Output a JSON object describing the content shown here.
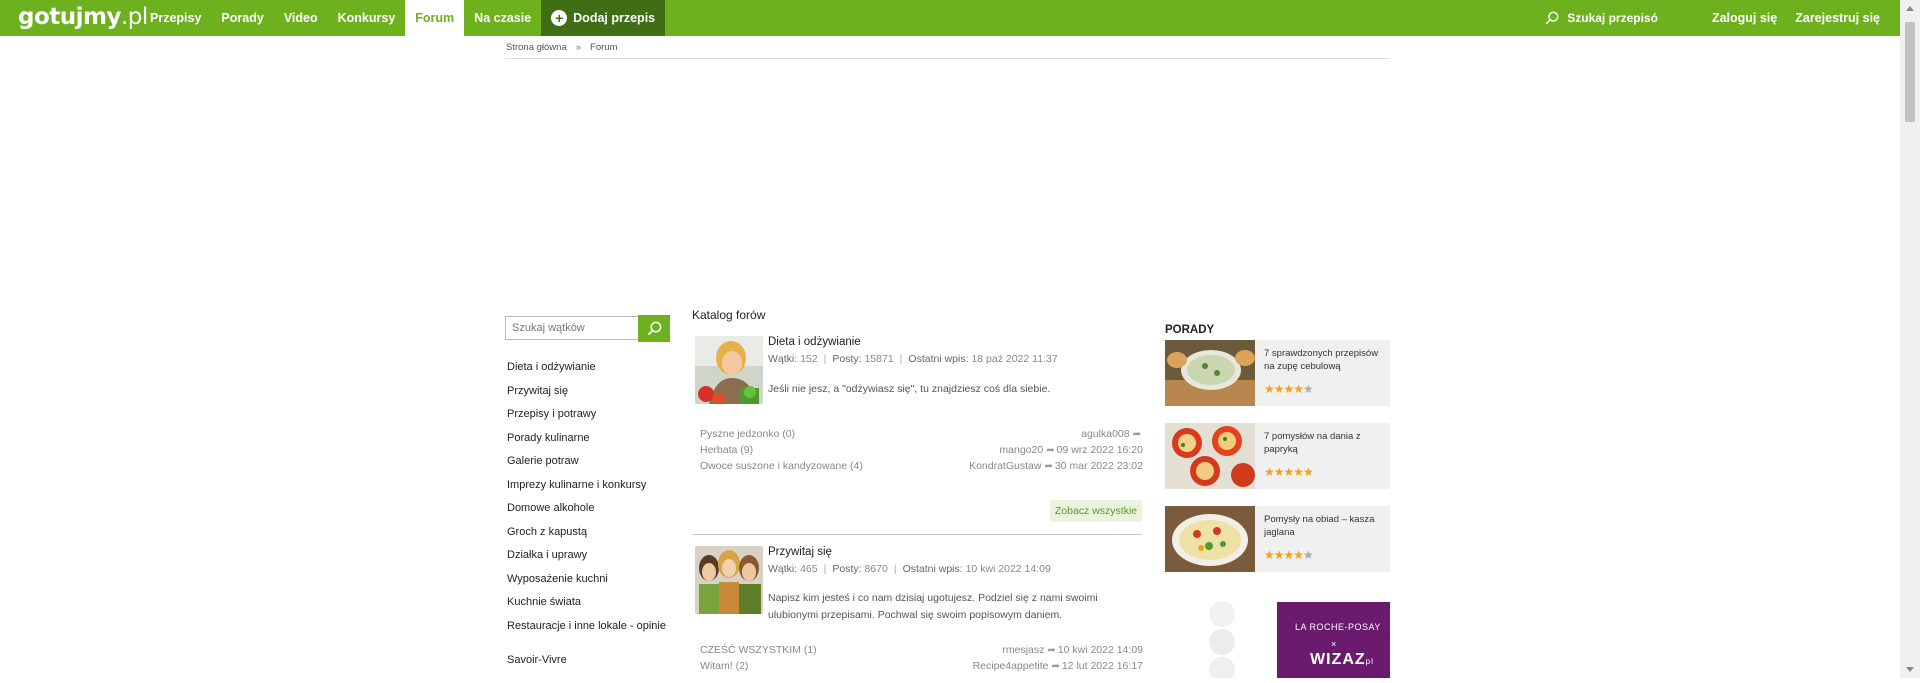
{
  "header": {
    "logo_main": "gotujmy",
    "logo_tld": ".pl",
    "nav": [
      {
        "label": "Przepisy"
      },
      {
        "label": "Porady"
      },
      {
        "label": "Video"
      },
      {
        "label": "Konkursy"
      },
      {
        "label": "Forum",
        "active": true
      },
      {
        "label": "Na czasie"
      }
    ],
    "add_recipe_label": "Dodaj przepis",
    "search_placeholder": "Szukaj przepisó",
    "login_label": "Zaloguj się",
    "register_label": "Zarejestruj się"
  },
  "breadcrumb": {
    "home": "Strona główna",
    "separator": "»",
    "current": "Forum"
  },
  "sidebar": {
    "search_placeholder": "Szukaj wątków",
    "items": [
      "Dieta i odżywianie",
      "Przywitaj się",
      "Przepisy i potrawy",
      "Porady kulinarne",
      "Galerie potraw",
      "Imprezy kulinarne i konkursy",
      "Domowe alkohole",
      "Groch z kapustą",
      "Działka i uprawy",
      "Wyposażenie kuchni",
      "Kuchnie świata",
      "Restauracje i inne lokale - opinie",
      "Savoir-Vivre"
    ]
  },
  "catalog": {
    "title": "Katalog forów",
    "forums": [
      {
        "title": "Dieta i odżywianie",
        "threads_label": "Wątki:",
        "threads": "152",
        "posts_label": "Posty:",
        "posts": "15871",
        "last_label": "Ostatni wpis:",
        "last": "18 paź 2022 11:37",
        "description": "Jeśli nie jesz, a \"odżywiasz się\", tu znajdziesz coś dla siebie.",
        "threads_list": [
          {
            "title": "Pyszne jedzonko",
            "count": "(0)",
            "user": "agulka008",
            "date": ""
          },
          {
            "title": "Herbata",
            "count": "(9)",
            "user": "mango20",
            "date": "09 wrz 2022 16:20"
          },
          {
            "title": "Owoce suszone i kandyzowane",
            "count": "(4)",
            "user": "KondratGustaw",
            "date": "30 mar 2022 23:02"
          }
        ],
        "see_all": "Zobacz wszystkie"
      },
      {
        "title": "Przywitaj się",
        "threads_label": "Wątki:",
        "threads": "465",
        "posts_label": "Posty:",
        "posts": "8670",
        "last_label": "Ostatni wpis:",
        "last": "10 kwi 2022 14:09",
        "description": "Napisz kim jesteś i co nam dzisiaj ugotujesz. Podziel się z nami swoimi ulubionymi przepisami. Pochwal się swoim popisowym daniem.",
        "threads_list": [
          {
            "title": "CZEŚĆ WSZYSTKIM",
            "count": "(1)",
            "user": "rmesjasz",
            "date": "10 kwi 2022 14:09"
          },
          {
            "title": "Witam!",
            "count": "(2)",
            "user": "Recipe4appetite",
            "date": "12 lut 2022 16:17"
          }
        ]
      }
    ]
  },
  "porady": {
    "title": "PORADY",
    "items": [
      {
        "text": "7 sprawdzonych przepisów na zupę cebulową",
        "rating": 4
      },
      {
        "text": "7 pomysłów na dania z papryką",
        "rating": 5
      },
      {
        "text": "Pomysły na obiad – kasza jaglana",
        "rating": 4
      }
    ]
  },
  "ad": {
    "brand": "LA ROCHE-POSAY",
    "x": "×",
    "partner": "WIZAZ",
    "partner_tld": "pl"
  },
  "colors": {
    "brand_green": "#6eb11f",
    "dark_green": "#3f6e14",
    "star": "#f4a11d"
  }
}
